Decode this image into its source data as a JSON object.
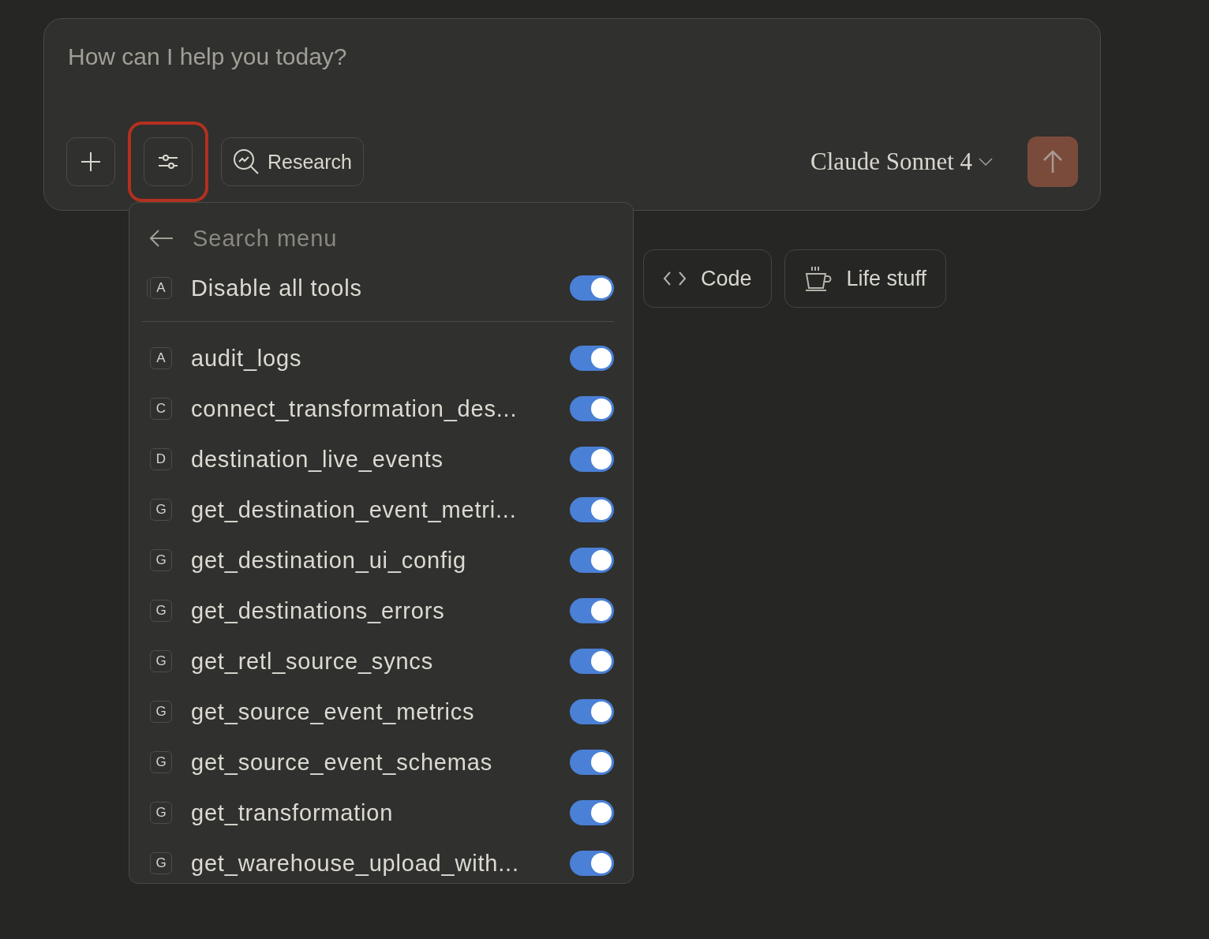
{
  "composer": {
    "placeholder": "How can I help you today?",
    "tools_button": {
      "highlighted": true
    },
    "research_button": {
      "label": "Research"
    },
    "model_selector": {
      "label": "Claude Sonnet 4"
    }
  },
  "menu": {
    "search": {
      "placeholder": "Search menu"
    },
    "master": {
      "letter": "A",
      "label": "Disable all tools",
      "on": true
    },
    "tools": [
      {
        "letter": "A",
        "name": "audit_logs",
        "on": true
      },
      {
        "letter": "C",
        "name": "connect_transformation_des...",
        "on": true
      },
      {
        "letter": "D",
        "name": "destination_live_events",
        "on": true
      },
      {
        "letter": "G",
        "name": "get_destination_event_metri...",
        "on": true
      },
      {
        "letter": "G",
        "name": "get_destination_ui_config",
        "on": true
      },
      {
        "letter": "G",
        "name": "get_destinations_errors",
        "on": true
      },
      {
        "letter": "G",
        "name": "get_retl_source_syncs",
        "on": true
      },
      {
        "letter": "G",
        "name": "get_source_event_metrics",
        "on": true
      },
      {
        "letter": "G",
        "name": "get_source_event_schemas",
        "on": true
      },
      {
        "letter": "G",
        "name": "get_transformation",
        "on": true
      },
      {
        "letter": "G",
        "name": "get_warehouse_upload_with...",
        "on": true
      }
    ]
  },
  "chips": [
    {
      "label": "Code",
      "kind": "code"
    },
    {
      "label": "Life stuff",
      "kind": "coffee"
    }
  ]
}
